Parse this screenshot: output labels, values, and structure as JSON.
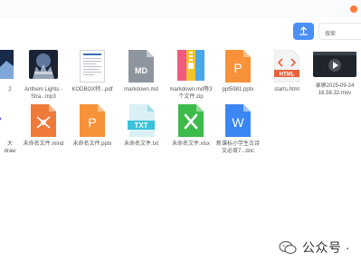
{
  "toolbar": {
    "search_placeholder": "搜索"
  },
  "files": [
    {
      "name": "2",
      "icon": "image-thumbnail-icon"
    },
    {
      "name": "Anthem Lights -\nStra...mp3",
      "icon": "audio-cover-icon"
    },
    {
      "name": "KODBOX特...pdf",
      "icon": "pdf-document-icon"
    },
    {
      "name": "markdown.md",
      "icon": "md-file-icon"
    },
    {
      "name": "markdown.md等3\n个文件.zip",
      "icon": "zip-archive-icon"
    },
    {
      "name": "ppt5981.pptx",
      "icon": "pptx-file-icon"
    },
    {
      "name": "starts.html",
      "icon": "html-file-icon"
    },
    {
      "name": "录屏2025-09-24\n16.58.32.mov",
      "icon": "video-file-icon"
    },
    {
      "name": "大\ndraw",
      "icon": "draw-file-icon"
    },
    {
      "name": "未命名文件.mind",
      "icon": "mind-map-icon"
    },
    {
      "name": "未命名文件.pptx",
      "icon": "pptx-file-icon"
    },
    {
      "name": "未命名文件.txt",
      "icon": "txt-file-icon"
    },
    {
      "name": "未命名文件.xlsx",
      "icon": "xlsx-file-icon"
    },
    {
      "name": "新课标小学生古诗\n文必背7...doc",
      "icon": "word-file-icon"
    }
  ],
  "watermark": {
    "text": "公众号 ·",
    "icon": "wechat-icon"
  },
  "colors": {
    "accent": "#4a90f5",
    "pptx": "#f7923a",
    "xlsx": "#3dbb4a",
    "word": "#3a86f2",
    "txt": "#39c2d8",
    "zip": "#f4c22b",
    "html": "#e8643c",
    "md": "#8e959e"
  }
}
